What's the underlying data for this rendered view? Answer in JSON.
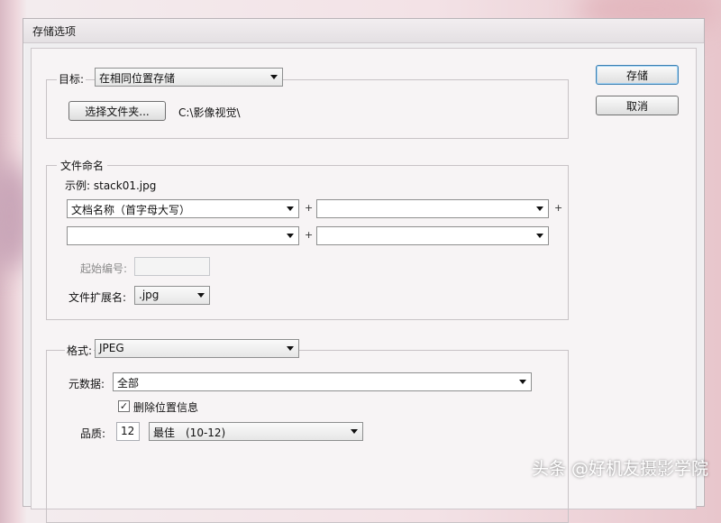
{
  "window": {
    "title": "存储选项"
  },
  "buttons": {
    "save": "存储",
    "cancel": "取消"
  },
  "destination": {
    "label": "目标:",
    "selected": "在相同位置存储",
    "choose_folder": "选择文件夹...",
    "path": "C:\\影像视觉\\"
  },
  "file_naming": {
    "title": "文件命名",
    "example": "示例: stack01.jpg",
    "field1": "文档名称（首字母大写）",
    "field2": "",
    "field3": "",
    "field4": "",
    "plus": "+",
    "start_number_label": "起始编号:",
    "start_number_value": "",
    "extension_label": "文件扩展名:",
    "extension_value": ".jpg"
  },
  "format": {
    "label": "格式:",
    "selected": "JPEG",
    "metadata_label": "元数据:",
    "metadata_value": "全部",
    "remove_location_label": "删除位置信息",
    "remove_location_checked": true,
    "check_glyph": "✓",
    "quality_label": "品质:",
    "quality_value": "12",
    "quality_preset": "最佳　(10-12)"
  },
  "watermark": "头条 @好机友摄影学院"
}
